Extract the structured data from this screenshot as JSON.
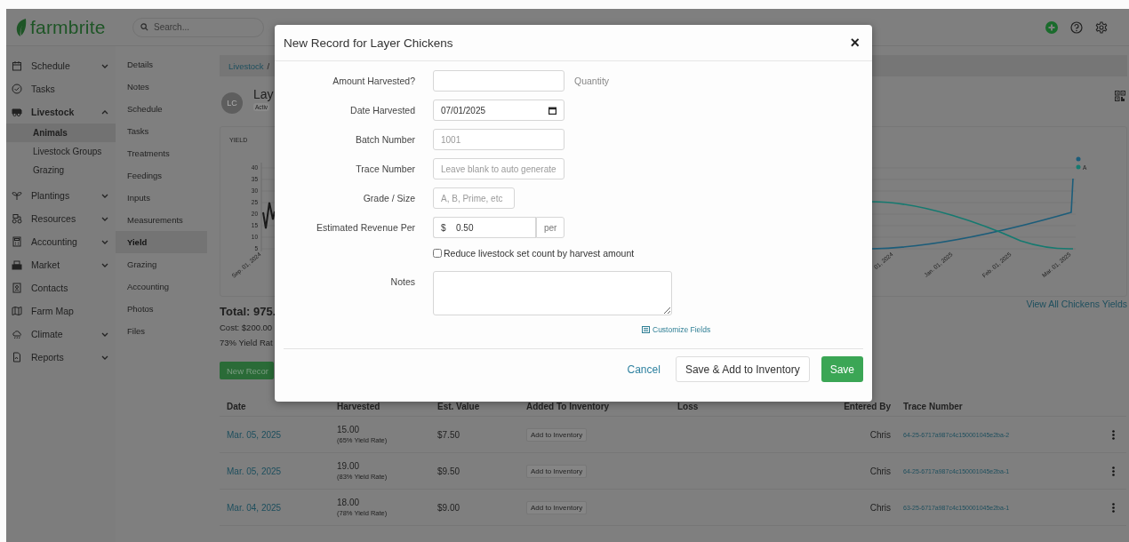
{
  "header": {
    "logo": "farmbrite",
    "search_placeholder": "Search..."
  },
  "sidebar": {
    "items": [
      {
        "label": "Schedule",
        "selected": false,
        "expanded": false
      },
      {
        "label": "Tasks",
        "selected": false
      },
      {
        "label": "Livestock",
        "selected": true,
        "expanded": true,
        "children": [
          {
            "label": "Animals",
            "selected": true
          },
          {
            "label": "Livestock Groups",
            "selected": false
          },
          {
            "label": "Grazing",
            "selected": false
          }
        ]
      },
      {
        "label": "Plantings",
        "selected": false,
        "expanded": false
      },
      {
        "label": "Resources",
        "selected": false,
        "expanded": false
      },
      {
        "label": "Accounting",
        "selected": false,
        "expanded": false
      },
      {
        "label": "Market",
        "selected": false,
        "expanded": false
      },
      {
        "label": "Contacts",
        "selected": false
      },
      {
        "label": "Farm Map",
        "selected": false
      },
      {
        "label": "Climate",
        "selected": false,
        "expanded": false
      },
      {
        "label": "Reports",
        "selected": false,
        "expanded": false
      }
    ]
  },
  "subnav": {
    "items": [
      {
        "label": "Details",
        "selected": false
      },
      {
        "label": "Notes",
        "selected": false
      },
      {
        "label": "Schedule",
        "selected": false
      },
      {
        "label": "Tasks",
        "selected": false
      },
      {
        "label": "Treatments",
        "selected": false
      },
      {
        "label": "Feedings",
        "selected": false
      },
      {
        "label": "Inputs",
        "selected": false
      },
      {
        "label": "Measurements",
        "selected": false
      },
      {
        "label": "Yield",
        "selected": true
      },
      {
        "label": "Grazing",
        "selected": false
      },
      {
        "label": "Accounting",
        "selected": false
      },
      {
        "label": "Photos",
        "selected": false
      },
      {
        "label": "Files",
        "selected": false
      }
    ]
  },
  "main": {
    "breadcrumb": {
      "link": "Livestock",
      "separator": "/"
    },
    "avatar": "LC",
    "title": "Lay",
    "status": "Activ",
    "chart": {
      "title": "YIELD",
      "y_ticks": [
        "40",
        "35",
        "30",
        "25",
        "20",
        "15",
        "10",
        "5"
      ],
      "left_x_labels": [
        "Sep. 01, 2024"
      ],
      "right_x_labels": [
        "01, 2024",
        "Jan. 01, 2025",
        "Feb. 01, 2025",
        "Mar. 01, 2025"
      ],
      "legend": [
        {
          "color": "#1c5d7a"
        },
        {
          "color": "#157a70",
          "label": "A"
        }
      ]
    },
    "view_all_link": "View All Chickens Yields",
    "total": "Total: 975.",
    "cost": "Cost: $200.00",
    "yield_rate": "73% Yield Rat",
    "new_record_button": "New Recor",
    "table": {
      "columns": [
        "Date",
        "Harvested",
        "Est. Value",
        "Added To Inventory",
        "Loss",
        "Entered By",
        "Trace Number"
      ],
      "rows": [
        {
          "date": "Mar. 05, 2025",
          "harvested": "15.00",
          "yield_rate": "(65% Yield Rate)",
          "value": "$7.50",
          "inventory_button": "Add to Inventory",
          "entered_by": "Chris",
          "trace": "64-25-6717a987c4c150001045e2ba-2"
        },
        {
          "date": "Mar. 05, 2025",
          "harvested": "19.00",
          "yield_rate": "(83% Yield Rate)",
          "value": "$9.50",
          "inventory_button": "Add to Inventory",
          "entered_by": "Chris",
          "trace": "64-25-6717a987c4c150001045e2ba-1"
        },
        {
          "date": "Mar. 04, 2025",
          "harvested": "18.00",
          "yield_rate": "(78% Yield Rate)",
          "value": "$9.00",
          "inventory_button": "Add to Inventory",
          "entered_by": "Chris",
          "trace": "63-25-6717a987c4c150001045e2ba-1"
        }
      ]
    }
  },
  "modal": {
    "title": "New Record for Layer Chickens",
    "close": "×",
    "fields": [
      {
        "kind": "text",
        "label": "Amount Harvested?",
        "hint": "Quantity"
      },
      {
        "kind": "date",
        "label": "Date Harvested",
        "value": "07/01/2025"
      },
      {
        "kind": "text",
        "label": "Batch Number",
        "placeholder": "1001"
      },
      {
        "kind": "text",
        "label": "Trace Number",
        "placeholder": "Leave blank to auto generate"
      },
      {
        "kind": "short",
        "label": "Grade / Size",
        "placeholder": "A, B, Prime, etc"
      },
      {
        "kind": "money",
        "label": "Estimated Revenue Per",
        "prefix": "$",
        "value": "0.50",
        "suffix": "per"
      }
    ],
    "checkbox": {
      "label": "Reduce livestock set count by harvest amount",
      "checked": false
    },
    "notes": {
      "label": "Notes"
    },
    "customize_link": "Customize Fields",
    "buttons": [
      {
        "kind": "link",
        "label": "Cancel"
      },
      {
        "kind": "secondary",
        "label": "Save & Add to Inventory"
      },
      {
        "kind": "primary",
        "label": "Save"
      }
    ]
  }
}
